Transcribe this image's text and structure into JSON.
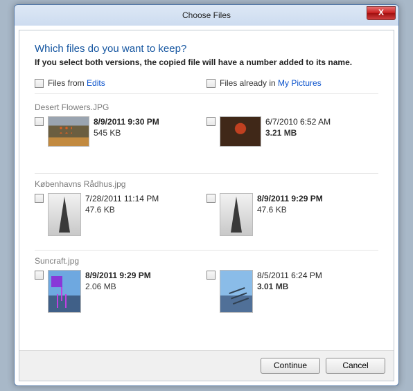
{
  "window": {
    "title": "Choose Files"
  },
  "close": {
    "glyph": "X"
  },
  "heading": "Which files do you want to keep?",
  "subheading": "If you select both versions, the copied file will have a number added to its name.",
  "columns": {
    "left_prefix": "Files from ",
    "left_link": "Edits",
    "right_prefix": "Files already in ",
    "right_link": "My Pictures"
  },
  "groups": [
    {
      "filename": "Desert Flowers.JPG",
      "thumb_shape": "landscape",
      "thumb_class_left": "t-flowers1",
      "thumb_class_right": "t-flowers2",
      "left": {
        "date": "8/9/2011 9:30 PM",
        "size": "545 KB",
        "date_bold": true,
        "size_bold": false
      },
      "right": {
        "date": "6/7/2010 6:52 AM",
        "size": "3.21 MB",
        "date_bold": false,
        "size_bold": true
      }
    },
    {
      "filename": "Københavns Rådhus.jpg",
      "thumb_shape": "portrait",
      "thumb_class_left": "t-tower",
      "thumb_class_right": "t-tower",
      "left": {
        "date": "7/28/2011 11:14 PM",
        "size": "47.6 KB",
        "date_bold": false,
        "size_bold": false
      },
      "right": {
        "date": "8/9/2011 9:29 PM",
        "size": "47.6 KB",
        "date_bold": true,
        "size_bold": false
      }
    },
    {
      "filename": "Suncraft.jpg",
      "thumb_shape": "portrait",
      "thumb_class_left": "t-sun1",
      "thumb_class_right": "t-sun2",
      "left": {
        "date": "8/9/2011 9:29 PM",
        "size": "2.06 MB",
        "date_bold": true,
        "size_bold": false
      },
      "right": {
        "date": "8/5/2011 6:24 PM",
        "size": "3.01 MB",
        "date_bold": false,
        "size_bold": true
      }
    }
  ],
  "buttons": {
    "continue": "Continue",
    "cancel": "Cancel"
  }
}
